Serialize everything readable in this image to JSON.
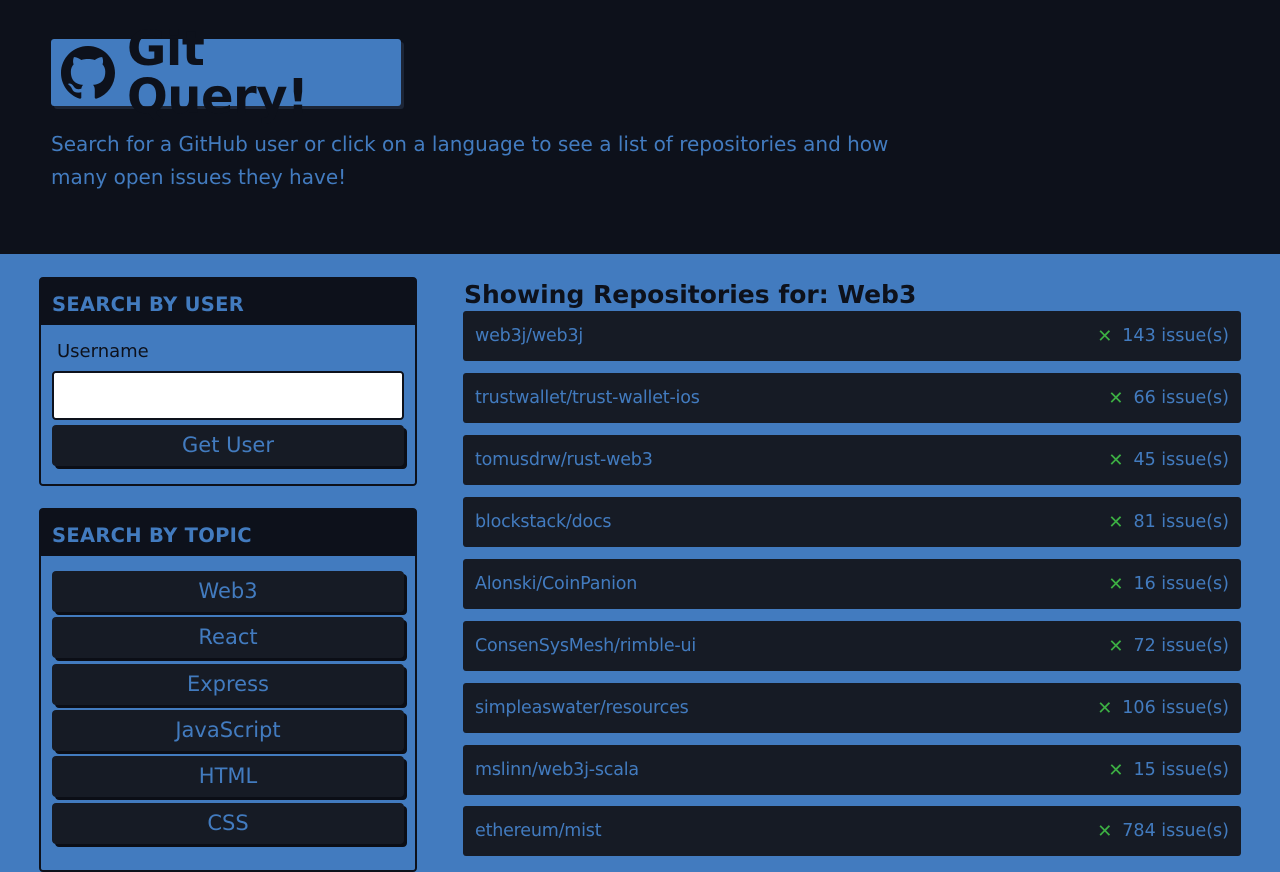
{
  "header": {
    "title": "Git Query!",
    "subtitle": "Search for a GitHub user or click on a language to see a list of repositories and how many open issues they have!"
  },
  "user_search": {
    "heading": "SEARCH BY USER",
    "username_label": "Username",
    "username_value": "",
    "button_label": "Get User"
  },
  "topic_search": {
    "heading": "SEARCH BY TOPIC",
    "topics": [
      "Web3",
      "React",
      "Express",
      "JavaScript",
      "HTML",
      "CSS"
    ]
  },
  "results": {
    "title": "Showing Repositories for: Web3",
    "repos": [
      {
        "name": "web3j/web3j",
        "issues": "143 issue(s)"
      },
      {
        "name": "trustwallet/trust-wallet-ios",
        "issues": "66 issue(s)"
      },
      {
        "name": "tomusdrw/rust-web3",
        "issues": "45 issue(s)"
      },
      {
        "name": "blockstack/docs",
        "issues": "81 issue(s)"
      },
      {
        "name": "Alonski/CoinPanion",
        "issues": "16 issue(s)"
      },
      {
        "name": "ConsenSysMesh/rimble-ui",
        "issues": "72 issue(s)"
      },
      {
        "name": "simpleaswater/resources",
        "issues": "106 issue(s)"
      },
      {
        "name": "mslinn/web3j-scala",
        "issues": "15 issue(s)"
      },
      {
        "name": "ethereum/mist",
        "issues": "784 issue(s)"
      }
    ]
  },
  "colors": {
    "dark": "#0d111b",
    "accent": "#427bbf",
    "button_bg": "#161b25",
    "issue_icon": "#3cb043"
  },
  "icons": {
    "logo": "github-icon",
    "issue": "x-icon"
  }
}
